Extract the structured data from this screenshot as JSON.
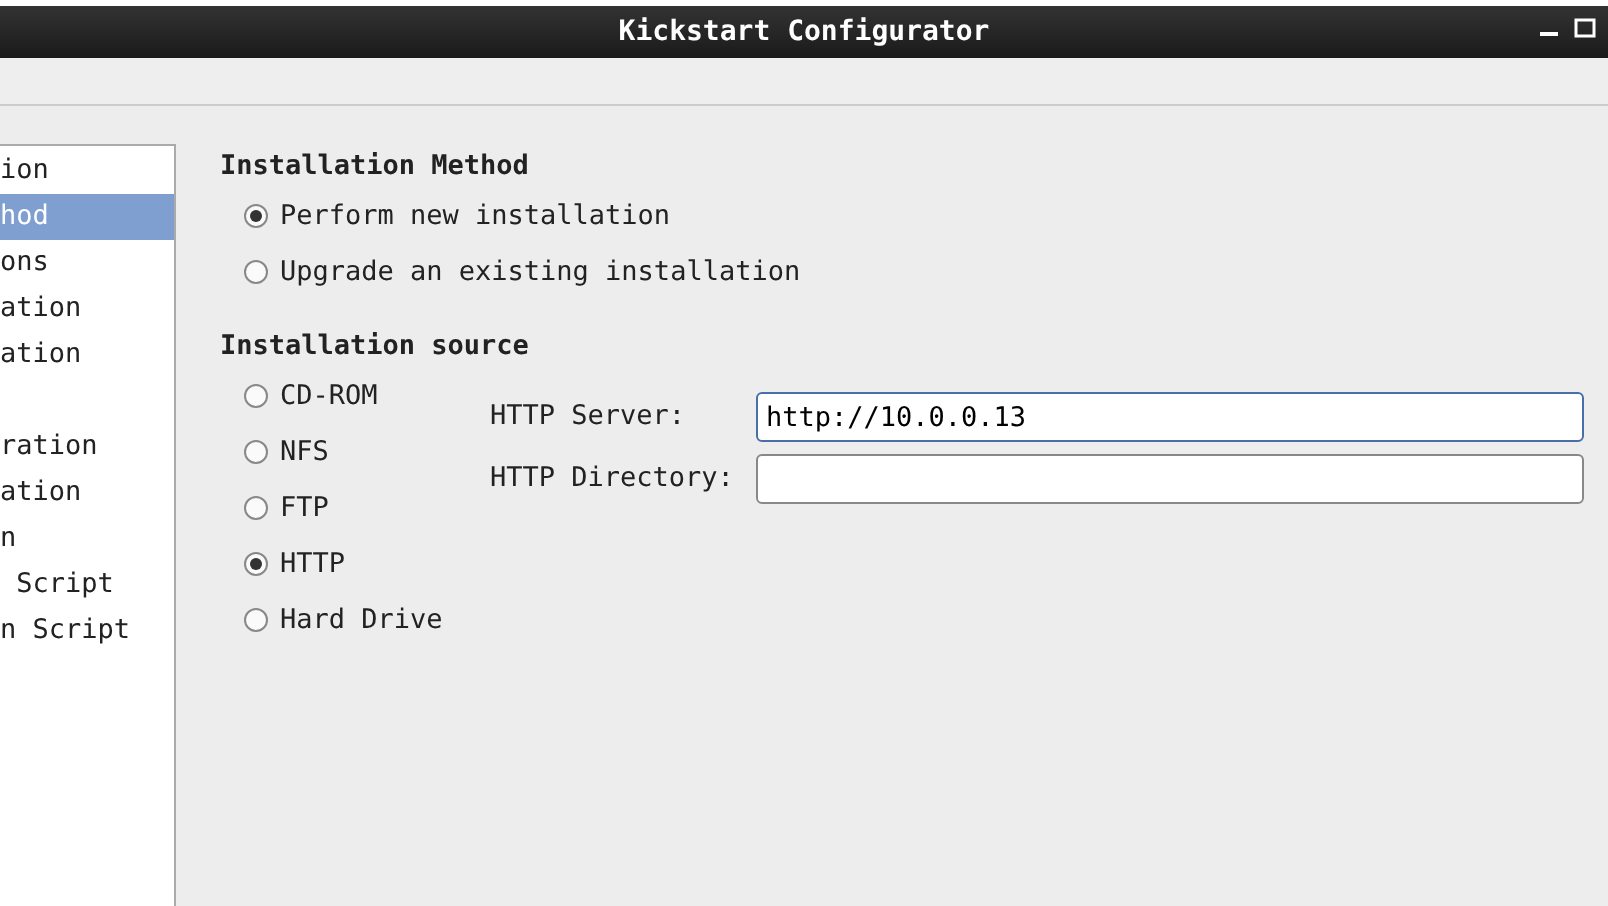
{
  "window": {
    "title": "Kickstart Configurator"
  },
  "sidebar": {
    "groups": [
      [
        {
          "label": "ion",
          "selected": false
        },
        {
          "label": "hod",
          "selected": true
        },
        {
          "label": "ons",
          "selected": false
        },
        {
          "label": "ation",
          "selected": false
        },
        {
          "label": "ation",
          "selected": false
        }
      ],
      [
        {
          "label": "ration",
          "selected": false
        },
        {
          "label": "ation",
          "selected": false
        },
        {
          "label": "n",
          "selected": false
        },
        {
          "label": " Script",
          "selected": false
        },
        {
          "label": "n Script",
          "selected": false
        }
      ]
    ]
  },
  "installation_method": {
    "heading": "Installation Method",
    "options": [
      {
        "label": "Perform new installation",
        "selected": true
      },
      {
        "label": "Upgrade an existing installation",
        "selected": false
      }
    ]
  },
  "installation_source": {
    "heading": "Installation source",
    "options": [
      {
        "label": "CD-ROM",
        "selected": false
      },
      {
        "label": "NFS",
        "selected": false
      },
      {
        "label": "FTP",
        "selected": false
      },
      {
        "label": "HTTP",
        "selected": true
      },
      {
        "label": "Hard Drive",
        "selected": false
      }
    ],
    "fields": [
      {
        "label": "HTTP Server:",
        "value": "http://10.0.0.13",
        "focused": true
      },
      {
        "label": "HTTP Directory:",
        "focused": false
      }
    ]
  }
}
